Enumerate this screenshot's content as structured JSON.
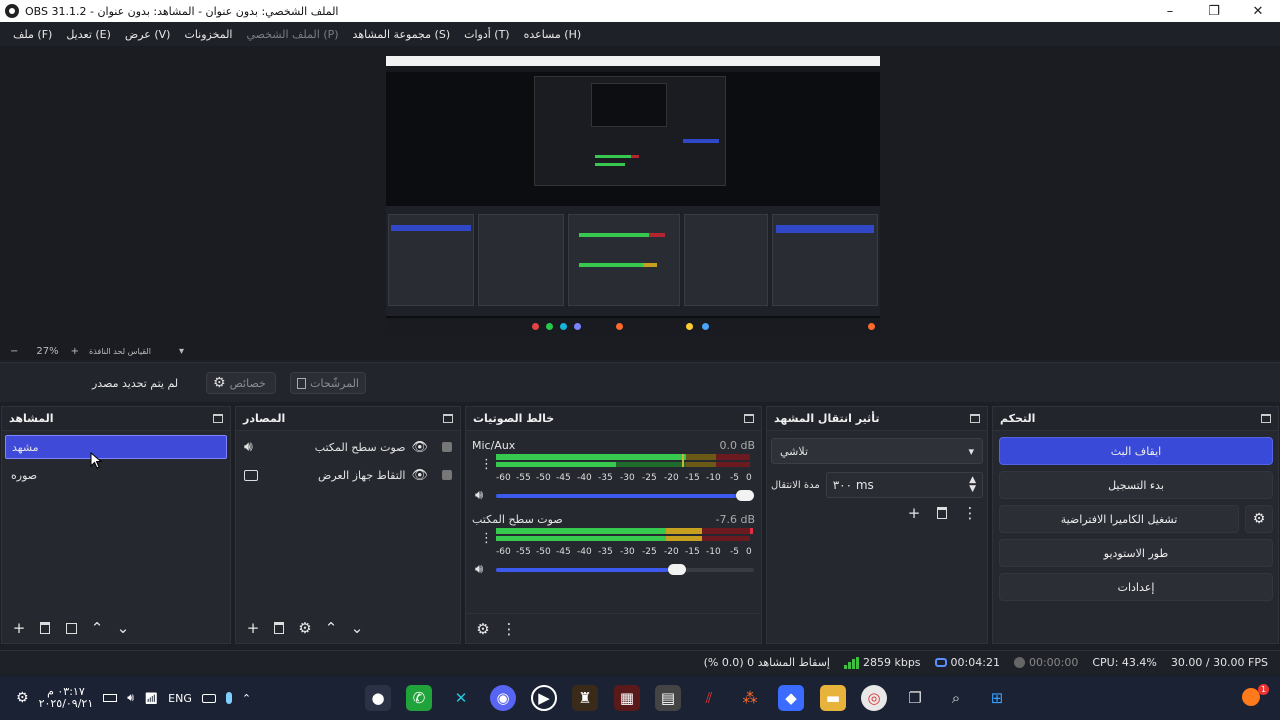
{
  "window": {
    "title": "OBS 31.1.2 - الملف الشخصي: بدون عنوان - المشاهد: بدون عنوان",
    "minimize": "–",
    "maximize": "❐",
    "close": "✕"
  },
  "menu": [
    {
      "label": "ملف (F)",
      "enabled": true
    },
    {
      "label": "تعديل (E)",
      "enabled": true
    },
    {
      "label": "عرض (V)",
      "enabled": true
    },
    {
      "label": "المخزونات",
      "enabled": true
    },
    {
      "label": "الملف الشخصي (P)",
      "enabled": false
    },
    {
      "label": "مجموعة المشاهد (S)",
      "enabled": true
    },
    {
      "label": "أدوات (T)",
      "enabled": true
    },
    {
      "label": "مساعده (H)",
      "enabled": true
    }
  ],
  "preview": {
    "zoom_minus": "−",
    "zoom_value": "27%",
    "zoom_plus": "+",
    "scale_label": "القياس لحد النافذة"
  },
  "source_toolbar": {
    "no_source": "لم يتم تحديد مصدر",
    "properties_label": "خصائص",
    "filters_label": "المرشّحات"
  },
  "scenes": {
    "title": "المشاهد",
    "items": [
      {
        "label": "مشهد",
        "selected": true
      },
      {
        "label": "صوره",
        "selected": false
      }
    ]
  },
  "sources": {
    "title": "المصادر",
    "items": [
      {
        "label": "صوت سطح المكتب",
        "type": "audio"
      },
      {
        "label": "التقاط جهاز العرض",
        "type": "display"
      }
    ]
  },
  "mixer": {
    "title": "خالط الصوتيات",
    "scale": [
      "-60",
      "-55",
      "-50",
      "-45",
      "-40",
      "-35",
      "-30",
      "-25",
      "-20",
      "-15",
      "-10",
      "-5",
      "0"
    ],
    "channels": [
      {
        "name": "Mic/Aux",
        "db": "0.0 dB",
        "volume": 1.0
      },
      {
        "name": "صوت سطح المكتب",
        "db": "-7.6 dB",
        "volume": 0.72
      }
    ]
  },
  "transitions": {
    "title": "تأثير انتقال المشهد",
    "selected": "تلاشي",
    "duration_label": "مدة الانتقال",
    "duration_value": "٣٠٠ ms"
  },
  "controls": {
    "title": "التحكم",
    "stop_stream": "ايقاف البث",
    "start_recording": "بدء التسجيل",
    "virtual_camera": "تشغيل الكاميرا الافتراضية",
    "studio_mode": "طور الاستوديو",
    "settings": "إعدادات"
  },
  "status": {
    "dropped": "إسقاط المشاهد 0 (0.0 %)",
    "kbps": "2859 kbps",
    "stream_time": "00:04:21",
    "rec_time": "00:00:00",
    "cpu": "CPU: 43.4%",
    "fps": "30.00 / 30.00 FPS"
  },
  "taskbar": {
    "time": "٠٣:١٧ م",
    "date": "٢٠٢٥/٠٩/٢١",
    "lang": "ENG",
    "notification_badge": "1"
  },
  "colors": {
    "accent": "#3f4bd8",
    "meter_green": "#37c84f",
    "meter_yellow": "#c8a01f",
    "meter_red": "#b32631",
    "stream_green": "#3fbf3f"
  }
}
